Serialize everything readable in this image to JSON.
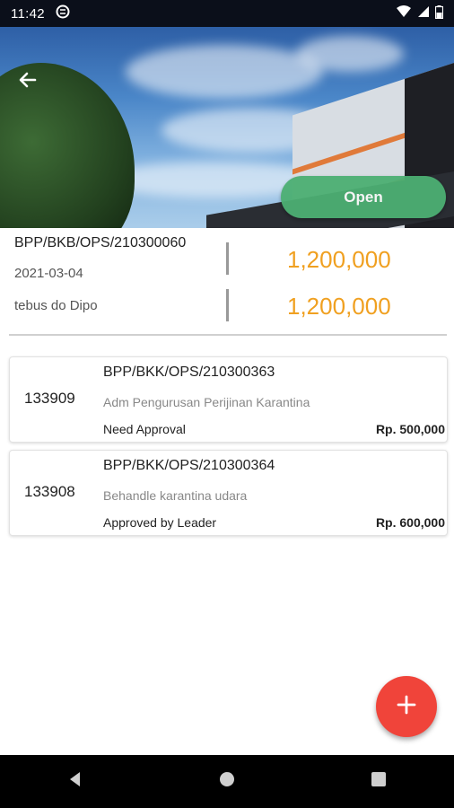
{
  "status_bar": {
    "time": "11:42"
  },
  "header": {
    "open_label": "Open"
  },
  "summary": {
    "doc_number": "BPP/BKB/OPS/210300060",
    "date": "2021-03-04",
    "description": "tebus do Dipo",
    "amount_1": "1,200,000",
    "amount_2": "1,200,000"
  },
  "items": [
    {
      "id": "133909",
      "ref": "BPP/BKK/OPS/210300363",
      "title": "Adm Pengurusan Perijinan Karantina",
      "status": "Need Approval",
      "price": "Rp. 500,000"
    },
    {
      "id": "133908",
      "ref": "BPP/BKK/OPS/210300364",
      "title": "Behandle karantina udara",
      "status": "Approved by Leader",
      "price": "Rp. 600,000"
    }
  ],
  "icons": {
    "back": "arrow-left-icon",
    "add": "plus-icon",
    "nav_back": "triangle-back-icon",
    "nav_home": "circle-home-icon",
    "nav_recents": "square-recents-icon"
  },
  "colors": {
    "open_button": "#4caf73",
    "amount": "#f0a020",
    "fab": "#f0443a"
  }
}
